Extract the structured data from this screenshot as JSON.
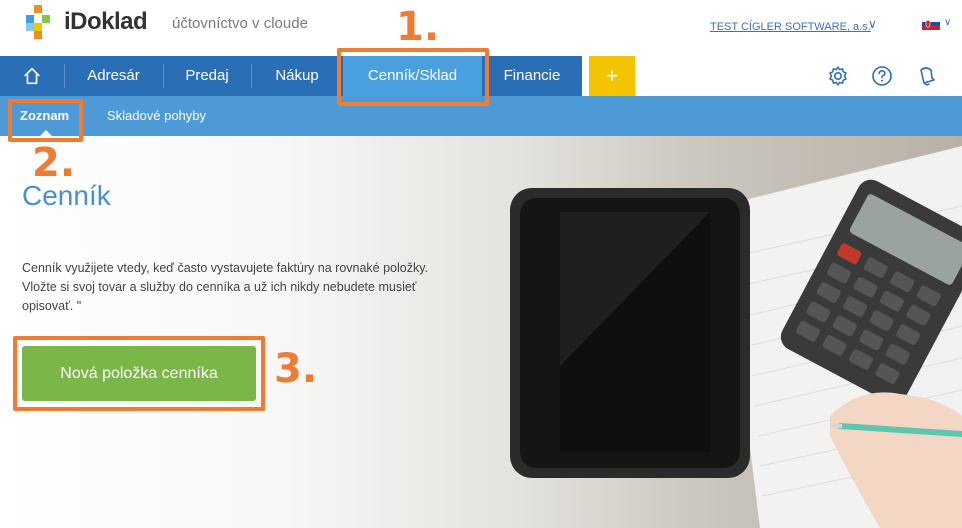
{
  "header": {
    "brand": "iDoklad",
    "tagline": "účtovníctvo v cloude",
    "company": "TEST CÍGLER SOFTWARE, a.s.",
    "language_flag": "slovakia-flag-icon"
  },
  "nav": {
    "home_icon": "home-icon",
    "items": [
      {
        "label": "Adresár"
      },
      {
        "label": "Predaj"
      },
      {
        "label": "Nákup"
      },
      {
        "label": "Cenník/Sklad"
      },
      {
        "label": "Financie"
      }
    ],
    "plus_label": "+",
    "settings_icon": "gear-icon",
    "help_icon": "help-icon",
    "notifications_icon": "notification-icon"
  },
  "subnav": {
    "items": [
      {
        "label": "Zoznam"
      },
      {
        "label": "Skladové pohyby"
      }
    ]
  },
  "main": {
    "title": "Cenník",
    "description": "Cenník využijete vtedy, keď často vystavujete faktúry na rovnaké položky. Vložte si svoj tovar a služby do cenníka a už ich nikdy nebudete musieť opisovať. \"",
    "new_item_button": "Nová položka cenníka"
  },
  "annotations": {
    "step1": "1.",
    "step2": "2.",
    "step3": "3."
  },
  "colors": {
    "nav_blue": "#2a6fb6",
    "subnav_blue": "#4d9ad7",
    "active_tab": "#4a9fde",
    "plus_yellow": "#f5c400",
    "button_green": "#7ab648",
    "annotation_orange": "#f07c32"
  }
}
